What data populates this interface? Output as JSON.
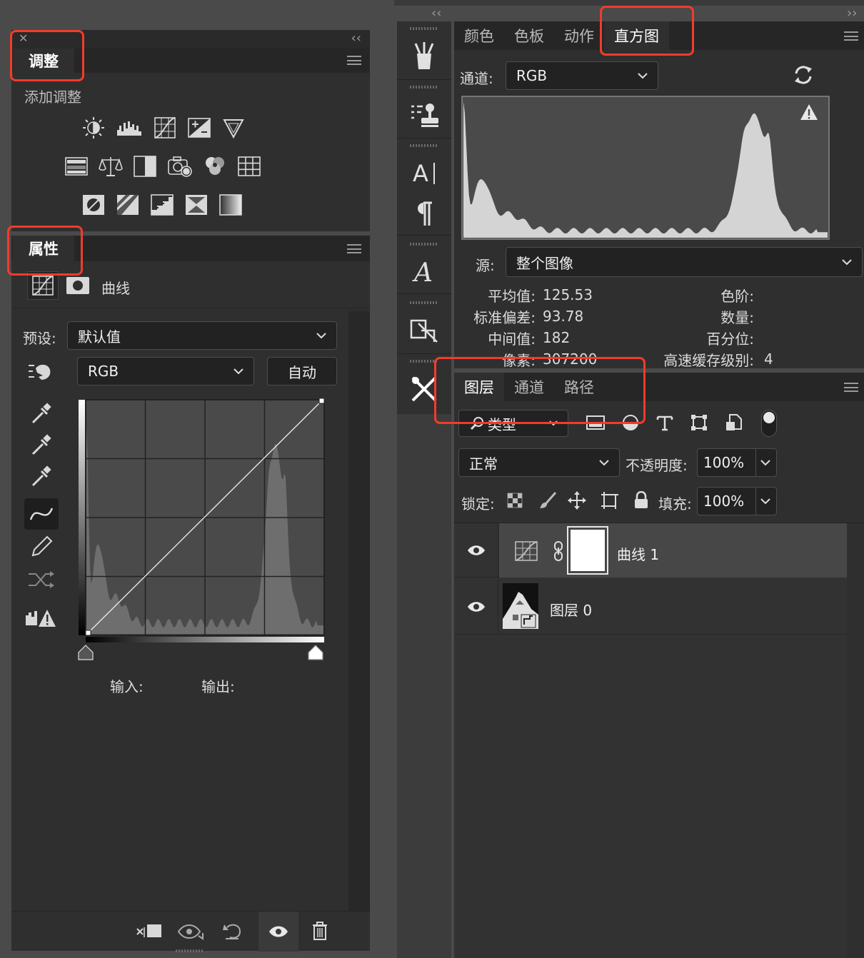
{
  "adjustments": {
    "close_glyph": "✕",
    "collapse_glyph": "‹‹",
    "tab_label": "调整",
    "add_label": "添加调整",
    "icons_row1": [
      "brightness-contrast-icon",
      "levels-icon",
      "curves-icon",
      "exposure-icon",
      "vibrance-icon"
    ],
    "icons_row2": [
      "hue-saturation-icon",
      "color-balance-icon",
      "black-white-icon",
      "photo-filter-icon",
      "channel-mixer-icon",
      "color-lookup-icon"
    ],
    "icons_row3": [
      "invert-icon",
      "posterize-icon",
      "threshold-icon",
      "selective-color-icon",
      "gradient-map-icon"
    ]
  },
  "properties": {
    "tab_label": "属性",
    "type_label": "曲线",
    "preset_label": "预设:",
    "preset_value": "默认值",
    "channel_value": "RGB",
    "auto_label": "自动",
    "input_label": "输入:",
    "output_label": "输出:"
  },
  "right_top": {
    "collapse_left": "‹‹",
    "collapse_right": "››",
    "tabs": [
      "颜色",
      "色板",
      "动作",
      "直方图"
    ],
    "active_tab": "直方图"
  },
  "histogram": {
    "channel_label": "通道:",
    "channel_value": "RGB",
    "source_label": "源:",
    "source_value": "整个图像",
    "stats_left": [
      {
        "label": "平均值:",
        "value": "125.53"
      },
      {
        "label": "标准偏差:",
        "value": "93.78"
      },
      {
        "label": "中间值:",
        "value": "182"
      },
      {
        "label": "像素:",
        "value": "307200"
      }
    ],
    "stats_right": [
      {
        "label": "色阶:",
        "value": ""
      },
      {
        "label": "数量:",
        "value": ""
      },
      {
        "label": "百分位:",
        "value": ""
      },
      {
        "label": "高速缓存级别:",
        "value": "4"
      }
    ]
  },
  "layers": {
    "tabs": [
      "图层",
      "通道",
      "路径"
    ],
    "active_tab": "图层",
    "filter_value": "类型",
    "blend_mode": "正常",
    "opacity_label": "不透明度:",
    "opacity_value": "100%",
    "lock_label": "锁定:",
    "fill_label": "填充:",
    "fill_value": "100%",
    "items": [
      {
        "name": "曲线 1",
        "selected": true
      },
      {
        "name": "图层 0",
        "selected": false
      }
    ]
  },
  "colors": {
    "highlight": "#f23c2a",
    "panel": "#2f2f2f",
    "tabbar": "#262626",
    "selected_row": "#474747"
  }
}
